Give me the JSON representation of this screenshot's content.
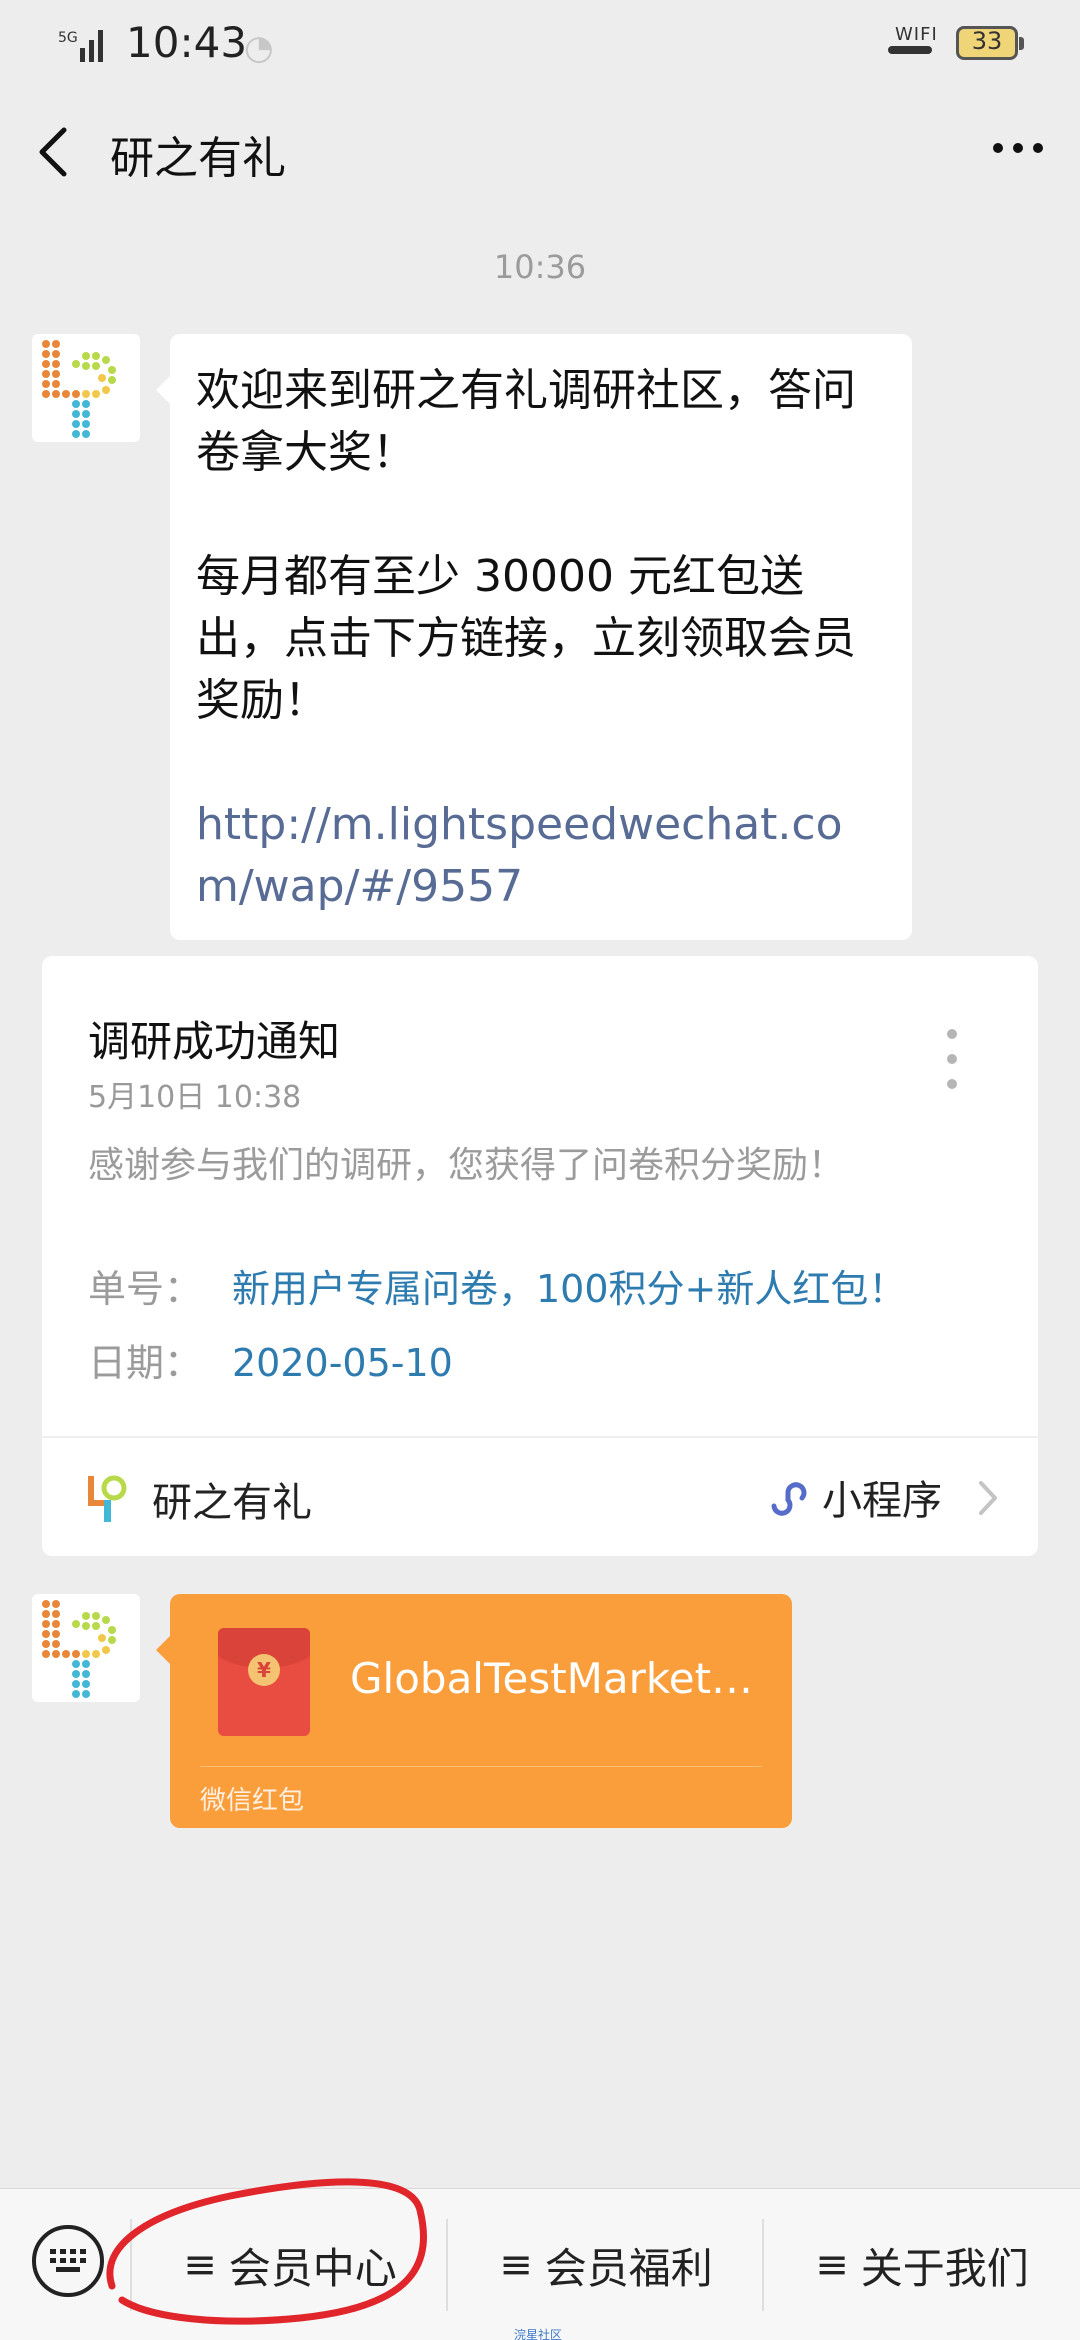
{
  "status_bar": {
    "network": "5G",
    "time": "10:43",
    "wifi_label": "WIFI",
    "battery": "33"
  },
  "nav": {
    "title": "研之有礼"
  },
  "chat": {
    "timestamp": "10:36",
    "welcome_message": {
      "line1": "欢迎来到研之有礼调研社区，答问卷拿大奖！",
      "line2": "每月都有至少 30000 元红包送出，点击下方链接，立刻领取会员奖励！",
      "link": "http://m.lightspeedwechat.com/wap/#/9557"
    },
    "notice_card": {
      "title": "调研成功通知",
      "date": "5月10日 10:38",
      "description": "感谢参与我们的调研，您获得了问卷积分奖励！",
      "order_label": "单号：",
      "order_value": "新用户专属问卷，100积分+新人红包！",
      "date_label": "日期：",
      "date_value": "2020-05-10",
      "footer_name": "研之有礼",
      "footer_type": "小程序"
    },
    "red_packet": {
      "title": "GlobalTestMarket…",
      "label": "微信红包"
    }
  },
  "bottom_menu": {
    "items": [
      {
        "label": "会员中心"
      },
      {
        "label": "会员福利"
      },
      {
        "label": "关于我们"
      }
    ],
    "hamburger": "≡"
  },
  "watermark": "浣星社区",
  "colors": {
    "background": "#ededed",
    "link": "#576b95",
    "card_value": "#2e7bb0",
    "red_packet": "#fa9d3b",
    "annotation": "#e0252b"
  }
}
